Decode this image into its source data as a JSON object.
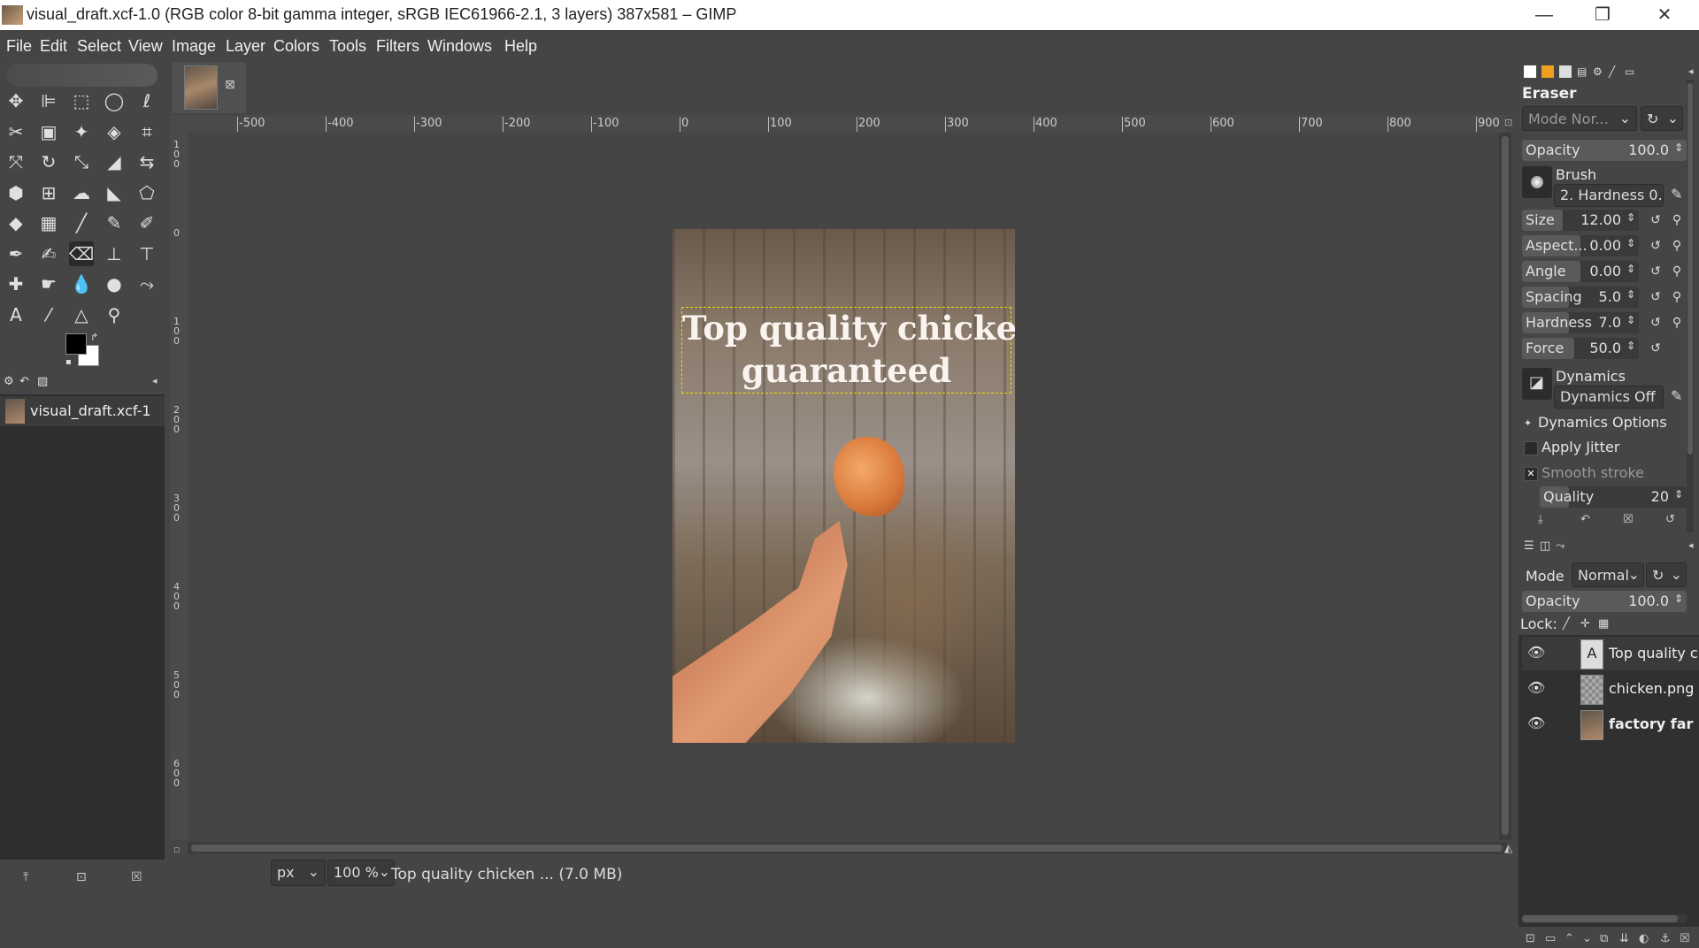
{
  "window": {
    "title": "visual_draft.xcf-1.0 (RGB color 8-bit gamma integer, sRGB IEC61966-2.1, 3 layers) 387x581 – GIMP",
    "minimize_icon": "minimize-icon",
    "maximize_icon": "restore-icon",
    "close_icon": "close-icon"
  },
  "menu": [
    "File",
    "Edit",
    "Select",
    "View",
    "Image",
    "Layer",
    "Colors",
    "Tools",
    "Filters",
    "Windows",
    "Help"
  ],
  "toolbox": {
    "tools": [
      {
        "name": "move-tool",
        "glyph": "✥"
      },
      {
        "name": "align-tool",
        "glyph": "⊫"
      },
      {
        "name": "rect-select-tool",
        "glyph": "⬚"
      },
      {
        "name": "ellipse-select-tool",
        "glyph": "◯"
      },
      {
        "name": "free-select-tool",
        "glyph": "ℓ"
      },
      {
        "name": "scissors-tool",
        "glyph": "✂"
      },
      {
        "name": "foreground-select-tool",
        "glyph": "▣"
      },
      {
        "name": "fuzzy-select-tool",
        "glyph": "✦"
      },
      {
        "name": "by-color-select-tool",
        "glyph": "◈"
      },
      {
        "name": "crop-tool",
        "glyph": "⌗"
      },
      {
        "name": "unified-transform-tool",
        "glyph": "⤧"
      },
      {
        "name": "rotate-tool",
        "glyph": "↻"
      },
      {
        "name": "scale-tool",
        "glyph": "⤡"
      },
      {
        "name": "shear-tool",
        "glyph": "◢"
      },
      {
        "name": "flip-tool",
        "glyph": "⇆"
      },
      {
        "name": "perspective-tool",
        "glyph": "⬢"
      },
      {
        "name": "3d-transform-tool",
        "glyph": "⊞"
      },
      {
        "name": "warp-tool",
        "glyph": "☁"
      },
      {
        "name": "handle-transform-tool",
        "glyph": "◣"
      },
      {
        "name": "cage-tool",
        "glyph": "⬠"
      },
      {
        "name": "bucket-fill-tool",
        "glyph": "◆"
      },
      {
        "name": "gradient-tool",
        "glyph": "▦"
      },
      {
        "name": "paintbrush-tool",
        "glyph": "╱"
      },
      {
        "name": "pencil-tool",
        "glyph": "✎"
      },
      {
        "name": "airbrush-tool",
        "glyph": "✐"
      },
      {
        "name": "ink-tool",
        "glyph": "✒"
      },
      {
        "name": "mypaint-brush-tool",
        "glyph": "✍"
      },
      {
        "name": "eraser-tool",
        "glyph": "⌫",
        "active": true
      },
      {
        "name": "clone-tool",
        "glyph": "⊥"
      },
      {
        "name": "perspective-clone-tool",
        "glyph": "⊤"
      },
      {
        "name": "heal-tool",
        "glyph": "✚"
      },
      {
        "name": "smudge-tool",
        "glyph": "☛"
      },
      {
        "name": "blur-tool",
        "glyph": "💧"
      },
      {
        "name": "dodge-burn-tool",
        "glyph": "●"
      },
      {
        "name": "paths-tool",
        "glyph": "⤳"
      },
      {
        "name": "text-tool",
        "glyph": "A"
      },
      {
        "name": "color-picker-tool",
        "glyph": "⁄"
      },
      {
        "name": "measure-tool",
        "glyph": "△"
      },
      {
        "name": "zoom-tool",
        "glyph": "⚲"
      }
    ],
    "fg_color": "#000000",
    "bg_color": "#ffffff"
  },
  "images_panel": {
    "item": "visual_draft.xcf-1"
  },
  "rulers": {
    "h_labels": [
      "-500",
      "-400",
      "-300",
      "-200",
      "-100",
      "0",
      "100",
      "200",
      "300",
      "400",
      "500",
      "600",
      "700",
      "800",
      "900"
    ],
    "v_labels": [
      "1\n0\n0",
      "0",
      "1\n0\n0",
      "2\n0\n0",
      "3\n0\n0",
      "4\n0\n0",
      "5\n0\n0",
      "6\n0\n0"
    ]
  },
  "canvas": {
    "text_line1": "Top quality chicken",
    "text_line2": "guaranteed"
  },
  "status": {
    "unit": "px",
    "zoom": "100 %",
    "message": "Top quality chicken ... (7.0 MB)"
  },
  "tool_options": {
    "title": "Eraser",
    "mode": "Mode Nor...",
    "opacity_label": "Opacity",
    "opacity_value": "100.0",
    "brush_label": "Brush",
    "brush_value": "2. Hardness 0.",
    "size_label": "Size",
    "size_value": "12.00",
    "aspect_label": "Aspect...",
    "aspect_value": "0.00",
    "angle_label": "Angle",
    "angle_value": "0.00",
    "spacing_label": "Spacing",
    "spacing_value": "5.0",
    "hardness_label": "Hardness",
    "hardness_value": "7.0",
    "force_label": "Force",
    "force_value": "50.0",
    "dynamics_label": "Dynamics",
    "dynamics_value": "Dynamics Off",
    "dynamics_options": "Dynamics Options",
    "apply_jitter": "Apply Jitter",
    "smooth_stroke": "Smooth stroke",
    "quality_label": "Quality",
    "quality_value": "20"
  },
  "layers": {
    "mode_label": "Mode",
    "mode_value": "Normal",
    "opacity_label": "Opacity",
    "opacity_value": "100.0",
    "lock_label": "Lock:",
    "items": [
      {
        "name": "Top quality c",
        "type": "text"
      },
      {
        "name": "chicken.png",
        "type": "image"
      },
      {
        "name": "factory far",
        "type": "image",
        "bold": true
      }
    ]
  }
}
